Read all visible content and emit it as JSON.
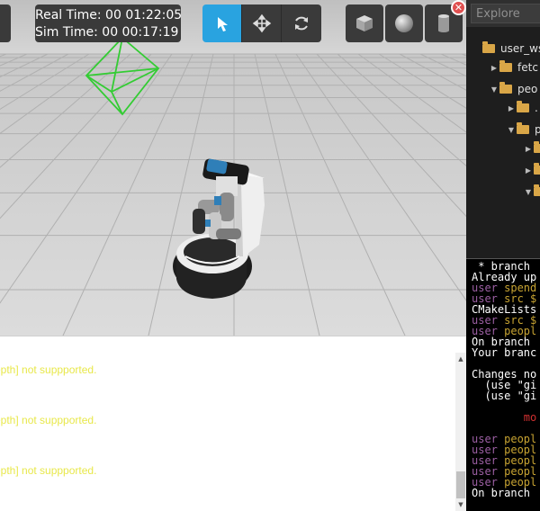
{
  "viewport": {
    "real_time": "Real Time: 00 01:22:05",
    "sim_time": "Sim Time: 00 00:17:19",
    "tools": [
      {
        "name": "select",
        "icon": "cursor-arrow-icon",
        "active": true
      },
      {
        "name": "translate",
        "icon": "move-arrows-icon",
        "active": false
      },
      {
        "name": "rotate",
        "icon": "rotate-icon",
        "active": false
      }
    ],
    "shapes": [
      {
        "name": "box",
        "icon": "cube-icon"
      },
      {
        "name": "sphere",
        "icon": "sphere-icon"
      },
      {
        "name": "cylinder",
        "icon": "cylinder-icon"
      }
    ],
    "colors": {
      "active": "#29a3e0",
      "toolbar": "#3a3a3a",
      "camera_frustum": "#33cc33"
    }
  },
  "console": {
    "lines": [
      "epth] not suppported.",
      "epth] not suppported.",
      "epth] not suppported."
    ]
  },
  "explorer": {
    "placeholder": "Explore",
    "close_label": "✕",
    "items": [
      {
        "label": "user_ws",
        "expanded": null
      },
      {
        "label": "fetc",
        "expanded": false
      },
      {
        "label": "peo",
        "expanded": true
      },
      {
        "label": ".",
        "expanded": false
      },
      {
        "label": "p",
        "expanded": true
      },
      {
        "label": "",
        "expanded": false
      },
      {
        "label": "",
        "expanded": false
      },
      {
        "label": "",
        "expanded": true
      }
    ]
  },
  "terminal": {
    "lines": [
      {
        "text": " * branch",
        "color": "white"
      },
      {
        "text": "Already up",
        "color": "white"
      },
      {
        "text": "user spend",
        "color": "mixed"
      },
      {
        "text": "user src $",
        "color": "mixed"
      },
      {
        "text": "CMakeLists",
        "color": "white"
      },
      {
        "text": "user src $",
        "color": "mixed"
      },
      {
        "text": "user peopl",
        "color": "mixed"
      },
      {
        "text": "On branch",
        "color": "white"
      },
      {
        "text": "Your branc",
        "color": "white"
      },
      {
        "text": "",
        "color": "white"
      },
      {
        "text": "Changes no",
        "color": "white"
      },
      {
        "text": "  (use \"gi",
        "color": "white"
      },
      {
        "text": "  (use \"gi",
        "color": "white"
      },
      {
        "text": "",
        "color": "white"
      },
      {
        "text": "        mo",
        "color": "red"
      },
      {
        "text": "",
        "color": "white"
      },
      {
        "text": "user peopl",
        "color": "mixed"
      },
      {
        "text": "user peopl",
        "color": "mixed"
      },
      {
        "text": "user peopl",
        "color": "mixed"
      },
      {
        "text": "user peopl",
        "color": "mixed"
      },
      {
        "text": "user peopl",
        "color": "mixed"
      },
      {
        "text": "On branch",
        "color": "white"
      }
    ]
  }
}
